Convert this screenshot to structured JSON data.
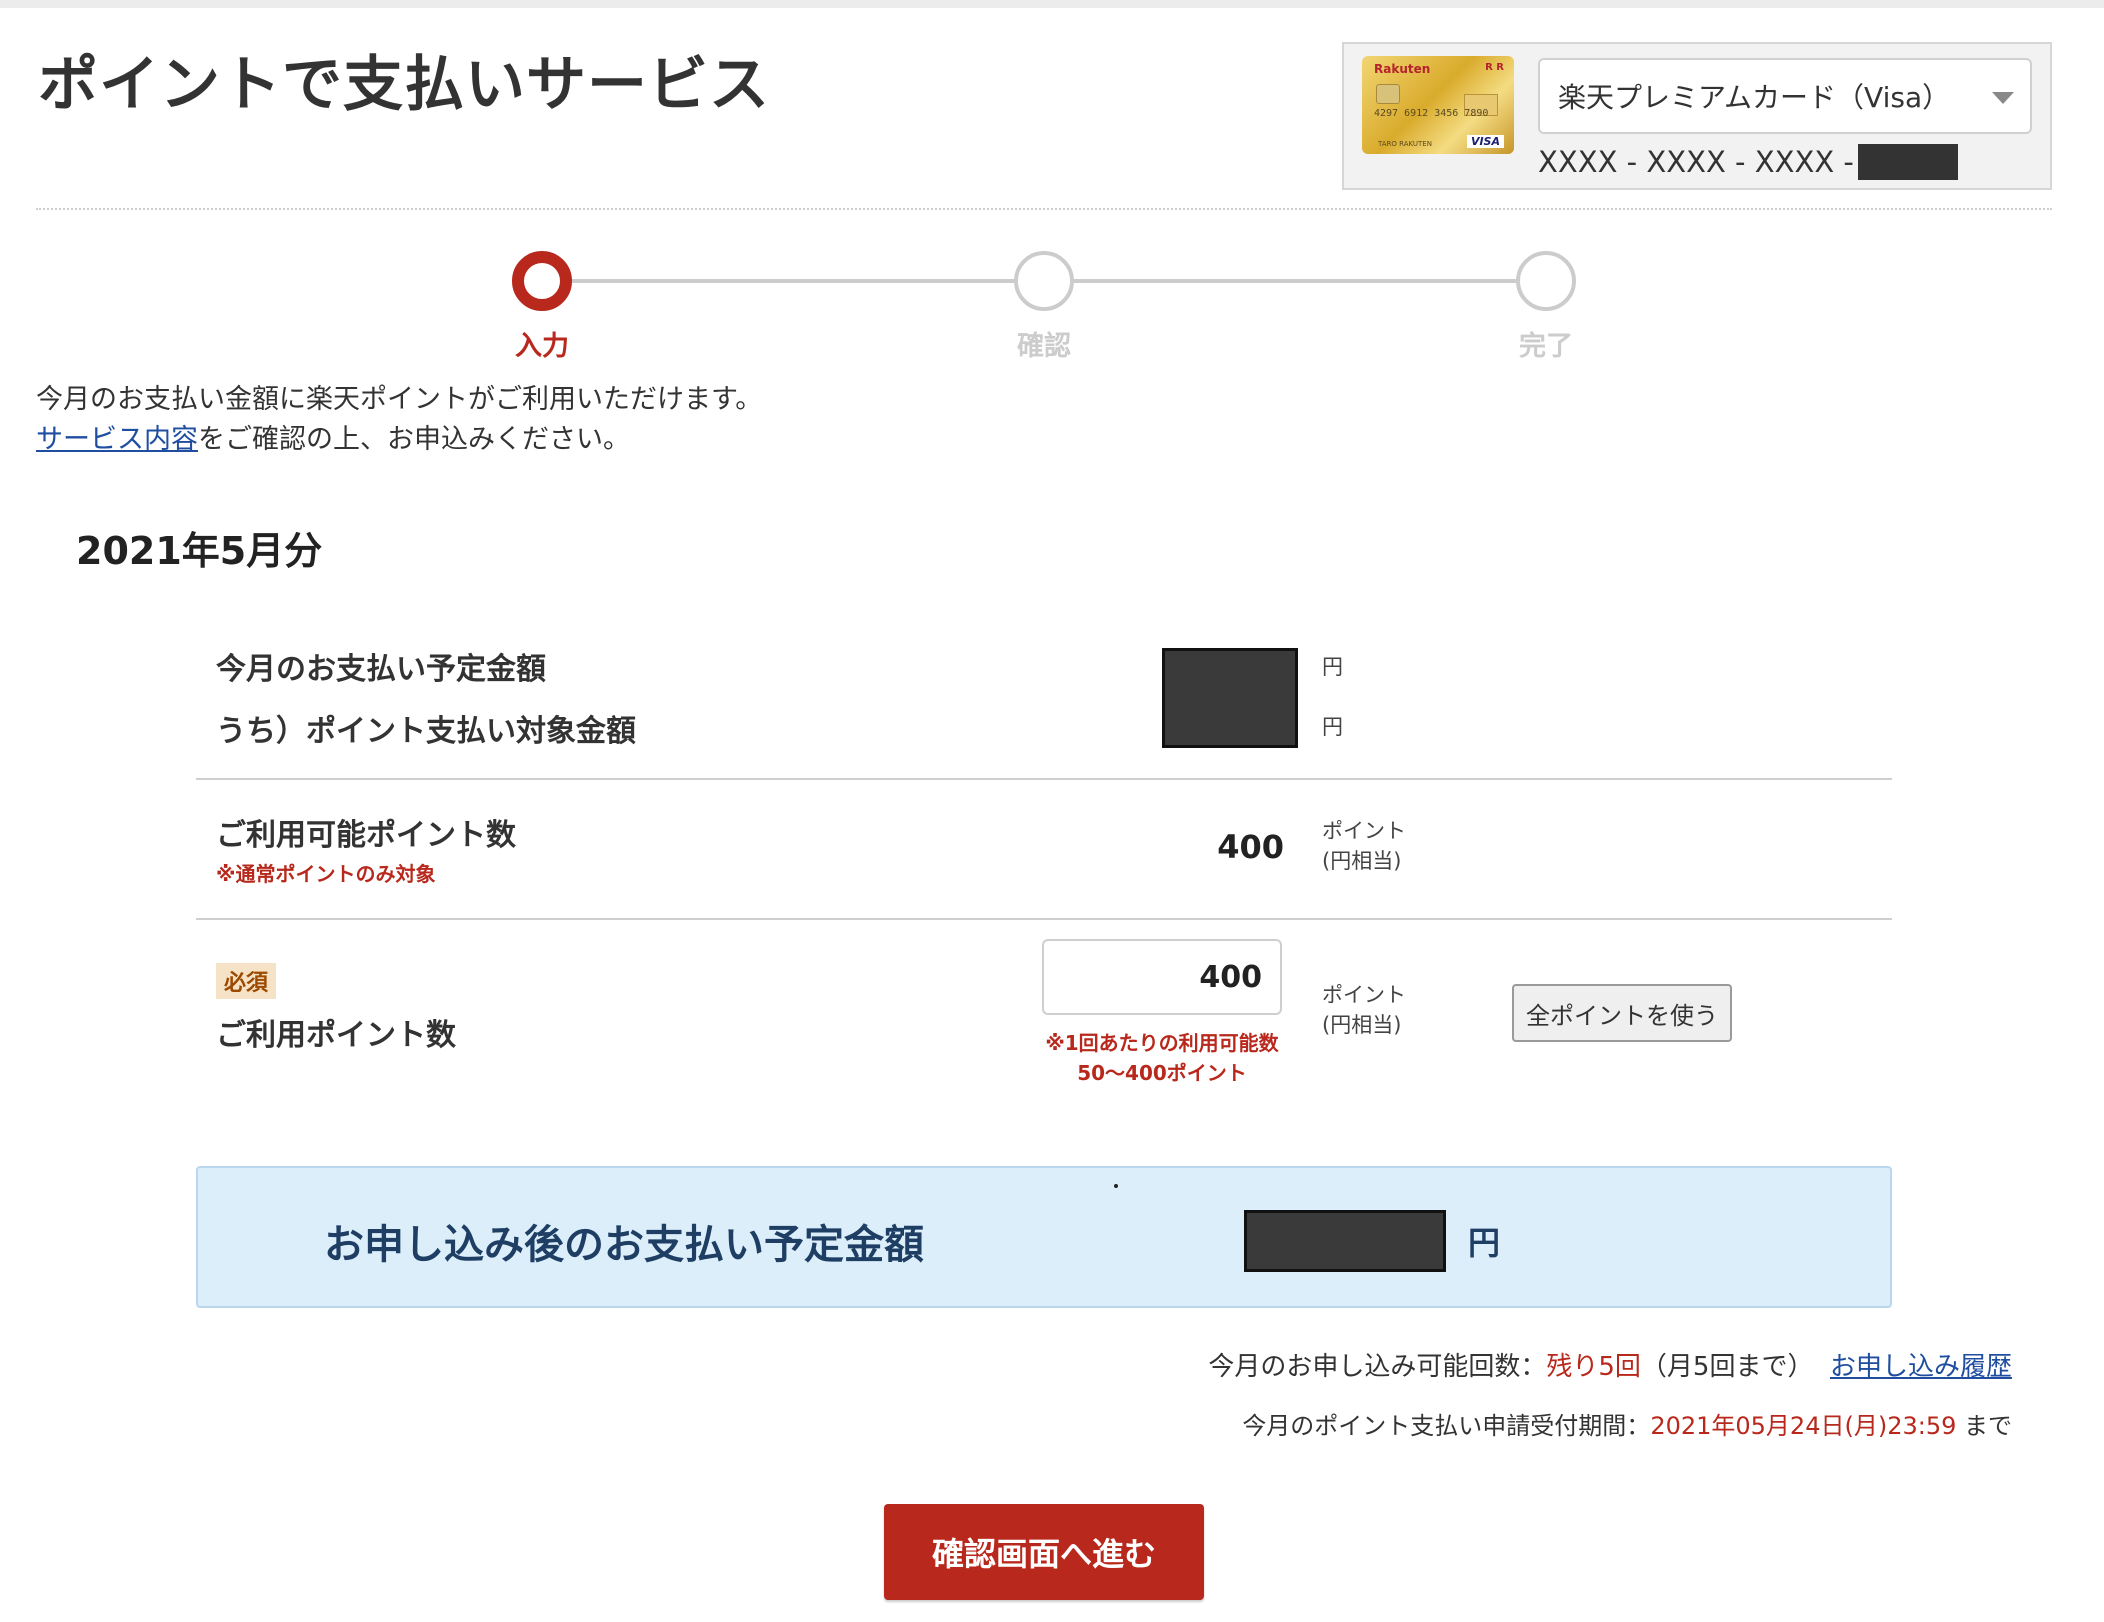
{
  "page": {
    "title": "ポイントで支払いサービス"
  },
  "card": {
    "brand_logo": "Rakuten",
    "brand_mark": "R R",
    "number_art": "4297 6912 3456 7890",
    "holder_art": "TARO RAKUTEN",
    "network": "VISA",
    "selected": "楽天プレミアムカード（Visa）",
    "number_masked": "XXXX - XXXX - XXXX -"
  },
  "steps": [
    {
      "label": "入力",
      "active": true
    },
    {
      "label": "確認",
      "active": false
    },
    {
      "label": "完了",
      "active": false
    }
  ],
  "intro": {
    "line1": "今月のお支払い金額に楽天ポイントがご利用いただけます。",
    "link": "サービス内容",
    "line2_rest": "をご確認の上、お申込みください。"
  },
  "month_title": "2021年5月分",
  "rows": {
    "scheduled_label": "今月のお支払い予定金額",
    "target_label": "うち）ポイント支払い対象金額",
    "yen": "円",
    "available_label": "ご利用可能ポイント数",
    "available_note": "※通常ポイントのみ対象",
    "available_value": "400",
    "point_unit": "ポイント",
    "point_unit_sub": "(円相当)",
    "use_badge": "必須",
    "use_label": "ご利用ポイント数",
    "use_value": "400",
    "use_note1": "※1回あたりの利用可能数",
    "use_note2": "50〜400ポイント",
    "all_points_button": "全ポイントを使う"
  },
  "result": {
    "label": "お申し込み後のお支払い予定金額",
    "yen": "円"
  },
  "info": {
    "count_prefix": "今月のお申し込み可能回数：",
    "count_value": "残り5回",
    "count_suffix": "（月5回まで）",
    "history_link": "お申し込み履歴",
    "period_prefix": "今月のポイント支払い申請受付期間：",
    "period_value": "2021年05月24日(月)23:59",
    "period_suffix": " まで"
  },
  "submit_button": "確認画面へ進む",
  "colors": {
    "accent": "#b8281c",
    "link": "#1f4ea0",
    "result_bg": "#ddeefb"
  }
}
